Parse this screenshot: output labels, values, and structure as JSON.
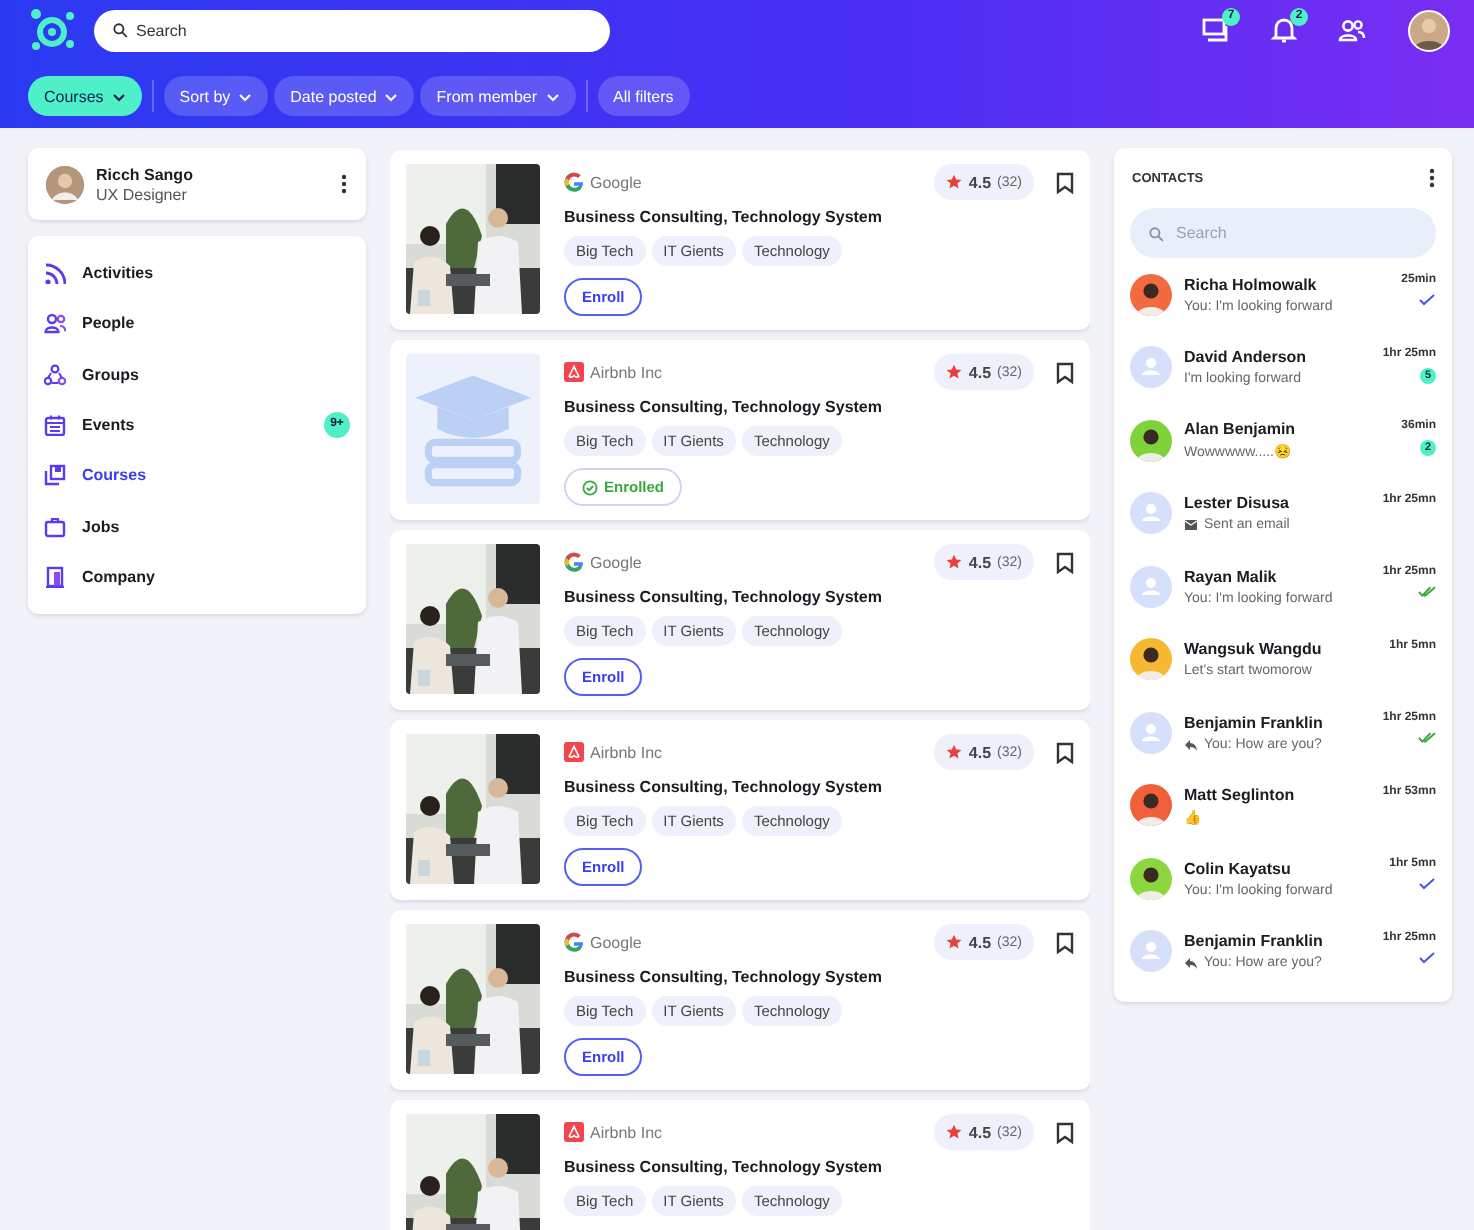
{
  "header": {
    "search": {
      "placeholder": "Search"
    },
    "messages_badge": "7",
    "notifications_badge": "2"
  },
  "filters": [
    {
      "label": "Courses",
      "selected": true,
      "dropdown": true
    },
    {
      "label": "Sort by",
      "selected": false,
      "dropdown": true
    },
    {
      "label": "Date posted",
      "selected": false,
      "dropdown": true
    },
    {
      "label": "From member",
      "selected": false,
      "dropdown": true
    },
    {
      "label": "All filters",
      "selected": false,
      "dropdown": false
    }
  ],
  "profile": {
    "name": "Ricch Sango",
    "role": "UX Designer"
  },
  "nav": [
    {
      "kind": "rss",
      "label": "Activities",
      "selected": false
    },
    {
      "kind": "people",
      "label": "People",
      "selected": false
    },
    {
      "kind": "groups",
      "label": "Groups",
      "selected": false
    },
    {
      "kind": "calendar",
      "label": "Events",
      "selected": false,
      "badge": "9+"
    },
    {
      "kind": "courses",
      "label": "Courses",
      "selected": true
    },
    {
      "kind": "briefcase",
      "label": "Jobs",
      "selected": false
    },
    {
      "kind": "building",
      "label": "Company",
      "selected": false
    }
  ],
  "courses": [
    {
      "company": {
        "kind": "google",
        "name": "Google"
      },
      "rating": "4.5",
      "reviews": "(32)",
      "title": "Business Consulting, Technology System",
      "tags": [
        "Big Tech",
        "IT Gients",
        "Technology"
      ],
      "action": {
        "label": "Enroll",
        "enrolled": false
      }
    },
    {
      "kind": "placeholder",
      "company": {
        "kind": "airbnb",
        "name": "Airbnb Inc"
      },
      "rating": "4.5",
      "reviews": "(32)",
      "title": "Business Consulting, Technology System",
      "tags": [
        "Big Tech",
        "IT Gients",
        "Technology"
      ],
      "action": {
        "label": "Enrolled",
        "enrolled": true
      }
    },
    {
      "company": {
        "kind": "google",
        "name": "Google"
      },
      "rating": "4.5",
      "reviews": "(32)",
      "title": "Business Consulting, Technology System",
      "tags": [
        "Big Tech",
        "IT Gients",
        "Technology"
      ],
      "action": {
        "label": "Enroll",
        "enrolled": false
      }
    },
    {
      "company": {
        "kind": "airbnb",
        "name": "Airbnb Inc"
      },
      "rating": "4.5",
      "reviews": "(32)",
      "title": "Business Consulting, Technology System",
      "tags": [
        "Big Tech",
        "IT Gients",
        "Technology"
      ],
      "action": {
        "label": "Enroll",
        "enrolled": false
      }
    },
    {
      "company": {
        "kind": "google",
        "name": "Google"
      },
      "rating": "4.5",
      "reviews": "(32)",
      "title": "Business Consulting, Technology System",
      "tags": [
        "Big Tech",
        "IT Gients",
        "Technology"
      ],
      "action": {
        "label": "Enroll",
        "enrolled": false
      }
    },
    {
      "company": {
        "kind": "airbnb",
        "name": "Airbnb Inc"
      },
      "rating": "4.5",
      "reviews": "(32)",
      "title": "Business Consulting, Technology System",
      "tags": [
        "Big Tech",
        "IT Gients",
        "Technology"
      ]
    }
  ],
  "contacts": {
    "title": "CONTACTS",
    "search": {
      "placeholder": "Search"
    },
    "items": [
      {
        "name": "Richa Holmowalk",
        "preview": {
          "kind": "text",
          "text": "You: I'm looking forward"
        },
        "time": "25min",
        "color": "#f26a3d",
        "kind": "read"
      },
      {
        "name": "David Anderson",
        "preview": {
          "kind": "text",
          "text": "I'm looking forward"
        },
        "time": "1hr 25mn",
        "kind": "unread",
        "unread": "5"
      },
      {
        "name": "Alan Benjamin",
        "preview": {
          "kind": "text",
          "text": "Wowwwww.....😣"
        },
        "time": "36min",
        "color": "#7ed23a",
        "kind": "unread",
        "unread": "2"
      },
      {
        "name": "Lester Disusa",
        "preview": {
          "kind": "email",
          "text": "Sent an email"
        },
        "time": "1hr 25mn",
        "kind": "plain"
      },
      {
        "name": "Rayan Malik",
        "preview": {
          "kind": "text",
          "text": "You: I'm looking forward"
        },
        "time": "1hr 25mn",
        "kind": "delivered"
      },
      {
        "name": "Wangsuk Wangdu",
        "preview": {
          "kind": "text",
          "text": "Let's start twomorow"
        },
        "time": "1hr 5mn",
        "color": "#f6b731",
        "kind": "plain"
      },
      {
        "name": "Benjamin Franklin",
        "preview": {
          "kind": "reply",
          "text": "You: How are you?"
        },
        "time": "1hr 25mn",
        "kind": "delivered"
      },
      {
        "name": "Matt Seglinton",
        "preview": {
          "kind": "text",
          "text": "👍"
        },
        "time": "1hr 53mn",
        "color": "#f0603a",
        "kind": "plain"
      },
      {
        "name": "Colin Kayatsu",
        "preview": {
          "kind": "text",
          "text": "You: I'm looking forward"
        },
        "time": "1hr 5mn",
        "color": "#8cd640",
        "kind": "read"
      },
      {
        "name": "Benjamin Franklin",
        "preview": {
          "kind": "reply",
          "text": "You: How are you?"
        },
        "time": "1hr 25mn",
        "kind": "read"
      }
    ]
  }
}
